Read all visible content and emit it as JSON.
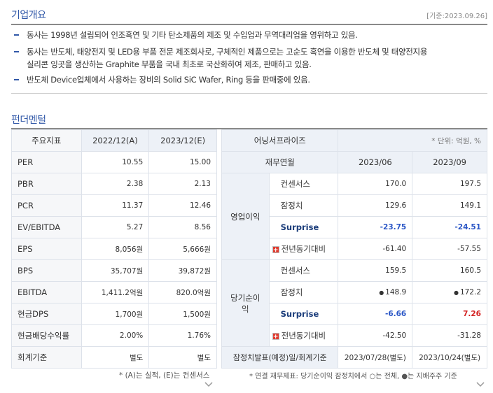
{
  "overview": {
    "title": "기업개요",
    "date": "[기준:2023.09.26]",
    "bullets": [
      "동사는 1998년 설립되어 인조흑연 및 기타 탄소제품의 제조 및 수입업과 무역대리업을 영위하고 있음.",
      "동사는 반도체, 태양전지 및 LED용 부품 전문 제조회사로, 구체적인 제품으로는 고순도 흑연을 이용한 반도체 및 태양전지용",
      "실리콘 잉곳을 생산하는 Graphite 부품을 국내 최초로 국산화하여 제조, 판매하고 있음.",
      "반도체 Device업체에서 사용하는 장비의 Solid SiC Wafer, Ring 등을 판매중에 있음."
    ]
  },
  "fundamental": {
    "title": "펀더멘털",
    "headers": [
      "주요지표",
      "2022/12(A)",
      "2023/12(E)"
    ],
    "rows": [
      [
        "PER",
        "10.55",
        "15.00"
      ],
      [
        "PBR",
        "2.38",
        "2.13"
      ],
      [
        "PCR",
        "11.37",
        "12.46"
      ],
      [
        "EV/EBITDA",
        "5.27",
        "8.56"
      ],
      [
        "EPS",
        "8,056원",
        "5,666원"
      ],
      [
        "BPS",
        "35,707원",
        "39,872원"
      ],
      [
        "EBITDA",
        "1,411.2억원",
        "820.0억원"
      ],
      [
        "현금DPS",
        "1,700원",
        "1,500원"
      ],
      [
        "현금배당수익률",
        "2.00%",
        "1.76%"
      ],
      [
        "회계기준",
        "별도",
        "별도"
      ]
    ],
    "footnote": "* (A)는 실적, (E)는 컨센서스"
  },
  "earnings": {
    "title": "어닝서프라이즈",
    "unit": "* 단위: 억원, %",
    "headers": [
      "재무연월",
      "2023/06",
      "2023/09"
    ],
    "groups": [
      {
        "name": "영업이익",
        "rows": [
          {
            "label": "컨센서스",
            "v1": "170.0",
            "v2": "197.5"
          },
          {
            "label": "잠정치",
            "v1": "129.6",
            "v2": "149.1"
          },
          {
            "label": "Surprise",
            "v1": "-23.75",
            "v2": "-24.51"
          },
          {
            "label": "전년동기대비",
            "v1": "-61.40",
            "v2": "-57.55"
          }
        ]
      },
      {
        "name": "당기순이익",
        "rows": [
          {
            "label": "컨센서스",
            "v1": "159.5",
            "v2": "160.5"
          },
          {
            "label": "잠정치",
            "v1": "148.9",
            "v2": "172.2"
          },
          {
            "label": "Surprise",
            "v1": "-6.66",
            "v2": "7.26"
          },
          {
            "label": "전년동기대비",
            "v1": "-42.50",
            "v2": "-31.28"
          }
        ]
      }
    ],
    "announce_label": "잠정치발표(예정)일/회계기준",
    "announce_v1": "2023/07/28(별도)",
    "announce_v2": "2023/10/24(별도)",
    "footnote": "* 연결 재무제표: 당기순이익 잠정치에서 ○는 전체, ●는 지배주주 기준",
    "colors": {
      "negative": "#2a56c6",
      "positive": "#d32222",
      "accent": "#3158a8"
    }
  }
}
